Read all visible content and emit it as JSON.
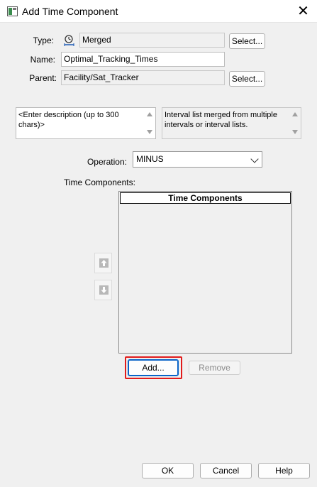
{
  "window": {
    "title": "Add Time Component",
    "close_glyph": "✕"
  },
  "form": {
    "type_label": "Type:",
    "type_value": "Merged",
    "type_icon": "clock-icon",
    "type_select_button": "Select...",
    "name_label": "Name:",
    "name_value": "Optimal_Tracking_Times",
    "parent_label": "Parent:",
    "parent_value": "Facility/Sat_Tracker",
    "parent_select_button": "Select..."
  },
  "description": {
    "user_text": "<Enter description (up to 300 chars)>",
    "info_text": "Interval list merged from multiple intervals or interval lists."
  },
  "operation": {
    "label": "Operation:",
    "selected": "MINUS"
  },
  "time_components": {
    "label": "Time Components:",
    "column_header": "Time Components",
    "items": [],
    "add_button": "Add...",
    "remove_button": "Remove"
  },
  "footer": {
    "ok_button": "OK",
    "cancel_button": "Cancel",
    "help_button": "Help"
  },
  "colors": {
    "highlight": "#e11b1b",
    "focus": "#0a64c8"
  }
}
